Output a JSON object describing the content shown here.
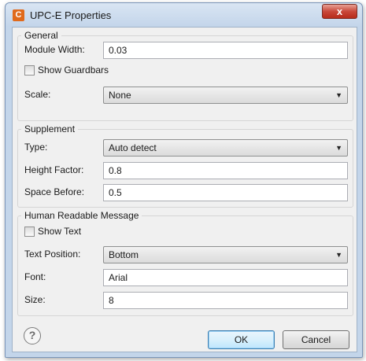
{
  "window": {
    "title": "UPC-E Properties",
    "app_icon_letter": "C",
    "close_glyph": "x"
  },
  "general": {
    "title": "General",
    "module_width_label": "Module Width:",
    "module_width_value": "0.03",
    "show_guardbars_label": "Show Guardbars",
    "show_guardbars_checked": false,
    "scale_label": "Scale:",
    "scale_value": "None"
  },
  "supplement": {
    "title": "Supplement",
    "type_label": "Type:",
    "type_value": "Auto detect",
    "height_factor_label": "Height Factor:",
    "height_factor_value": "0.8",
    "space_before_label": "Space Before:",
    "space_before_value": "0.5"
  },
  "human_readable": {
    "title": "Human Readable Message",
    "show_text_label": "Show Text",
    "show_text_checked": false,
    "text_position_label": "Text Position:",
    "text_position_value": "Bottom",
    "font_label": "Font:",
    "font_value": "Arial",
    "size_label": "Size:",
    "size_value": "8"
  },
  "footer": {
    "help_glyph": "?",
    "ok_label": "OK",
    "cancel_label": "Cancel"
  },
  "icons": {
    "dropdown": "chevron-down-icon",
    "help": "help-icon",
    "close": "close-icon",
    "app": "app-icon"
  }
}
